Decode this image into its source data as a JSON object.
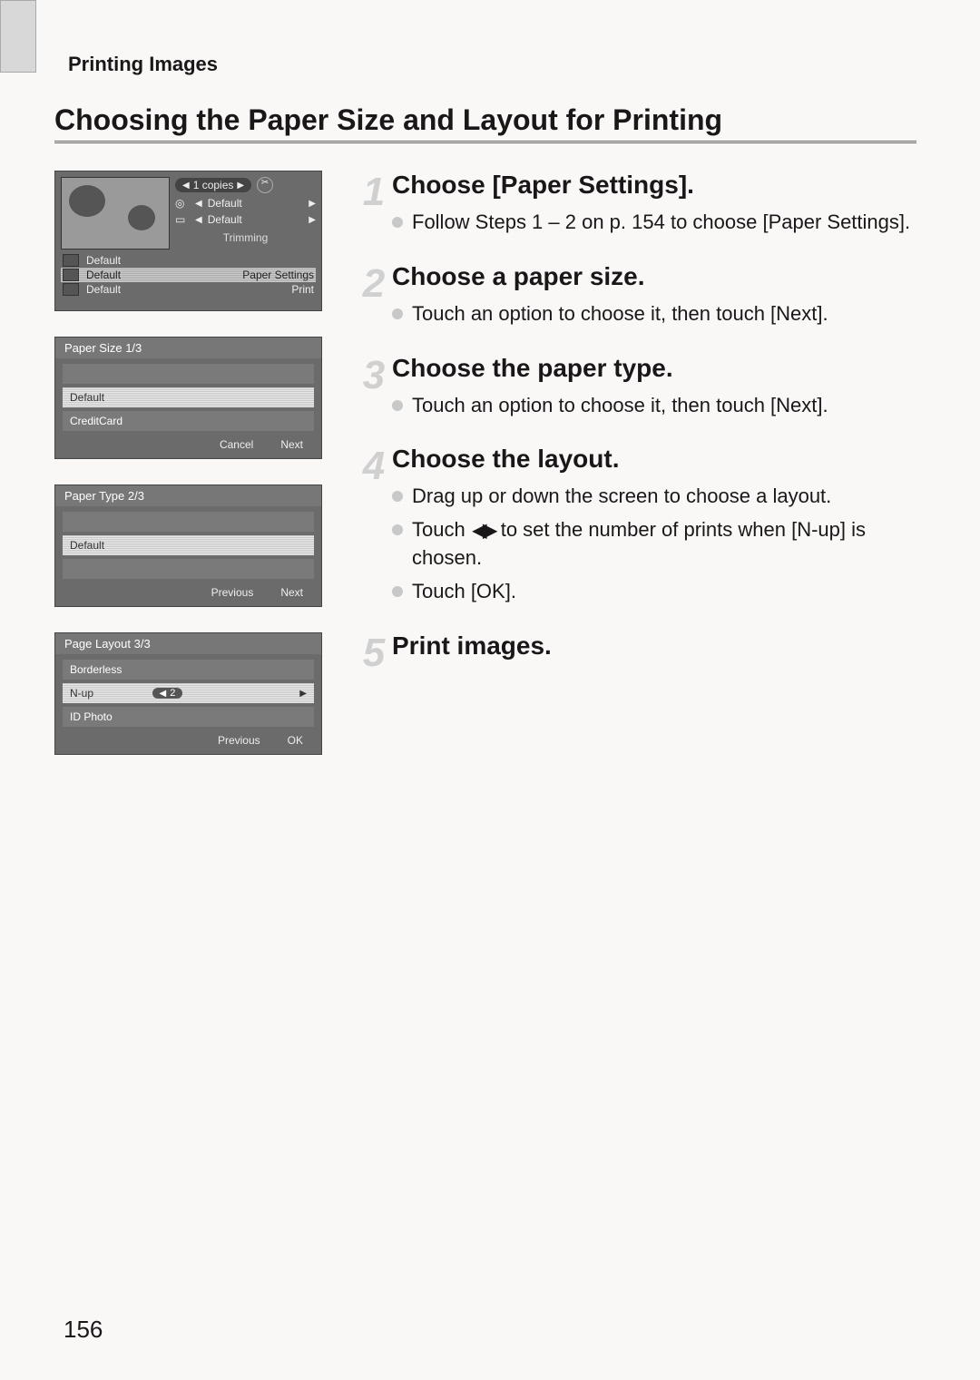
{
  "header": {
    "chapter_label": "Printing Images"
  },
  "section": {
    "title": "Choosing the Paper Size and Layout for Printing"
  },
  "page_number": "156",
  "panel1": {
    "copies": "1 copies",
    "default1": "Default",
    "default2": "Default",
    "trimming": "Trimming",
    "left_rows": [
      "Default",
      "Default",
      "Default"
    ],
    "paper_settings": "Paper Settings",
    "print": "Print"
  },
  "panel2": {
    "title": "Paper Size   1/3",
    "rows": [
      "",
      "Default",
      "CreditCard"
    ],
    "btn_left": "Cancel",
    "btn_right": "Next"
  },
  "panel3": {
    "title": "Paper Type   2/3",
    "rows": [
      "",
      "Default",
      ""
    ],
    "btn_left": "Previous",
    "btn_right": "Next"
  },
  "panel4": {
    "title": "Page Layout   3/3",
    "rows": [
      "Borderless",
      "N-up",
      "ID Photo"
    ],
    "nup_value": "2",
    "btn_left": "Previous",
    "btn_right": "OK"
  },
  "steps": [
    {
      "num": "1",
      "head": "Choose [Paper Settings].",
      "bullets": [
        "Follow Steps 1 – 2 on p. 154 to choose [Paper Settings]."
      ]
    },
    {
      "num": "2",
      "head": "Choose a paper size.",
      "bullets": [
        "Touch an option to choose it, then touch [Next]."
      ]
    },
    {
      "num": "3",
      "head": "Choose the paper type.",
      "bullets": [
        "Touch an option to choose it, then touch [Next]."
      ]
    },
    {
      "num": "4",
      "head": "Choose the layout.",
      "bullets": [
        "Drag up or down the screen to choose a layout.",
        "Touch ◀▶ to set the number of prints when [N-up] is chosen.",
        "Touch [OK]."
      ]
    },
    {
      "num": "5",
      "head": "Print images.",
      "bullets": []
    }
  ]
}
